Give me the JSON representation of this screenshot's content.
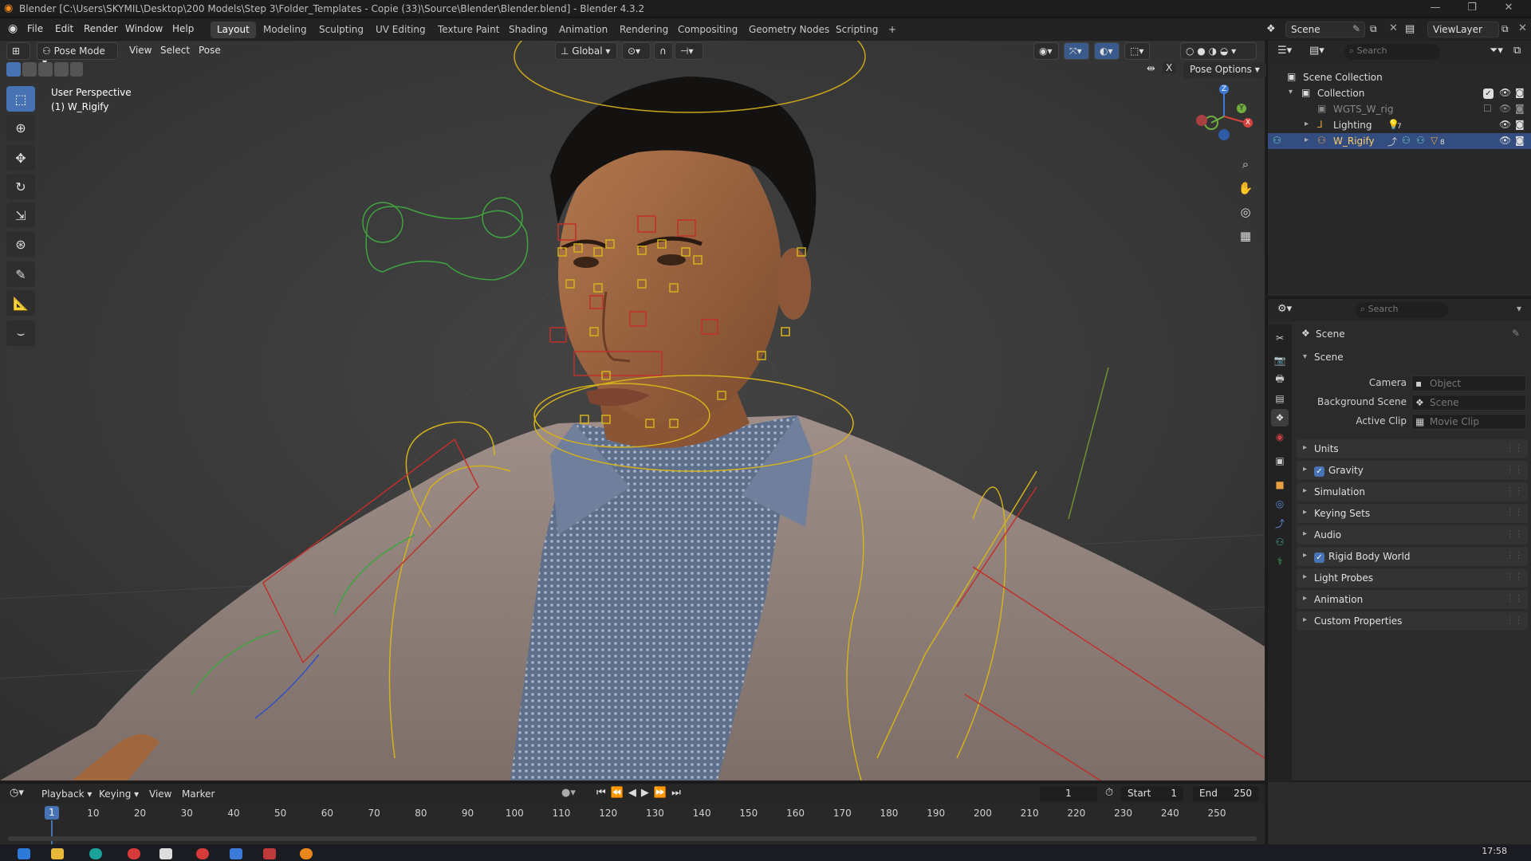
{
  "window": {
    "title": "Blender [C:\\Users\\SKYMIL\\Desktop\\200 Models\\Step 3\\Folder_Templates - Copie (33)\\Source\\Blender\\Blender.blend] - Blender 4.3.2",
    "controls": [
      "—",
      "❐",
      "✕"
    ]
  },
  "menubar": {
    "items": [
      "File",
      "Edit",
      "Render",
      "Window",
      "Help"
    ],
    "workspaces": [
      "Layout",
      "Modeling",
      "Sculpting",
      "UV Editing",
      "Texture Paint",
      "Shading",
      "Animation",
      "Rendering",
      "Compositing",
      "Geometry Nodes",
      "Scripting"
    ],
    "add_tab": "+",
    "scene_label": "Scene",
    "viewlayer_label": "ViewLayer"
  },
  "viewport": {
    "mode": "Pose Mode",
    "menus": [
      "View",
      "Select",
      "Pose"
    ],
    "orientation": "Global",
    "pose_options": "Pose Options",
    "overlay_text_1": "User Perspective",
    "overlay_text_2": "(1) W_Rigify",
    "gizmo": {
      "z": "Z",
      "y": "Y",
      "x": "X"
    }
  },
  "toolbar": {
    "tools": [
      "select-box",
      "cursor",
      "move",
      "rotate",
      "scale",
      "transform",
      "annotate",
      "measure",
      "breakdowner"
    ]
  },
  "outliner": {
    "search_placeholder": "Search",
    "items": [
      {
        "label": "Scene Collection",
        "indent": 0
      },
      {
        "label": "Collection",
        "indent": 1
      },
      {
        "label": "WGTS_W_rig",
        "indent": 2
      },
      {
        "label": "Lighting",
        "indent": 2,
        "badge": "7"
      },
      {
        "label": "W_Rigify",
        "indent": 2,
        "badge": "8",
        "selected": true
      }
    ]
  },
  "properties": {
    "search_placeholder": "Search",
    "breadcrumb": "Scene",
    "section": "Scene",
    "fields": [
      {
        "label": "Camera",
        "placeholder": "Object"
      },
      {
        "label": "Background Scene",
        "placeholder": "Scene"
      },
      {
        "label": "Active Clip",
        "placeholder": "Movie Clip"
      }
    ],
    "panels": [
      {
        "label": "Units",
        "checkbox": false
      },
      {
        "label": "Gravity",
        "checkbox": true
      },
      {
        "label": "Simulation",
        "checkbox": false
      },
      {
        "label": "Keying Sets",
        "checkbox": false
      },
      {
        "label": "Audio",
        "checkbox": false
      },
      {
        "label": "Rigid Body World",
        "checkbox": true
      },
      {
        "label": "Light Probes",
        "checkbox": false
      },
      {
        "label": "Animation",
        "checkbox": false
      },
      {
        "label": "Custom Properties",
        "checkbox": false
      }
    ]
  },
  "timeline": {
    "menus": [
      "Playback",
      "Keying",
      "View",
      "Marker"
    ],
    "current_frame": "1",
    "start_label": "Start",
    "start": "1",
    "end_label": "End",
    "end": "250",
    "playhead": "1",
    "ticks": [
      "10",
      "20",
      "30",
      "40",
      "50",
      "60",
      "70",
      "80",
      "90",
      "100",
      "110",
      "120",
      "130",
      "140",
      "150",
      "160",
      "170",
      "180",
      "190",
      "200",
      "210",
      "220",
      "230",
      "240",
      "250"
    ]
  },
  "taskbar": {
    "clock": "17:58"
  },
  "colors": {
    "accent": "#4772b3",
    "selection": "#334d80",
    "bone_yellow": "#d4b21a",
    "bone_red": "#c0302a",
    "bone_green": "#2f9a2f"
  }
}
